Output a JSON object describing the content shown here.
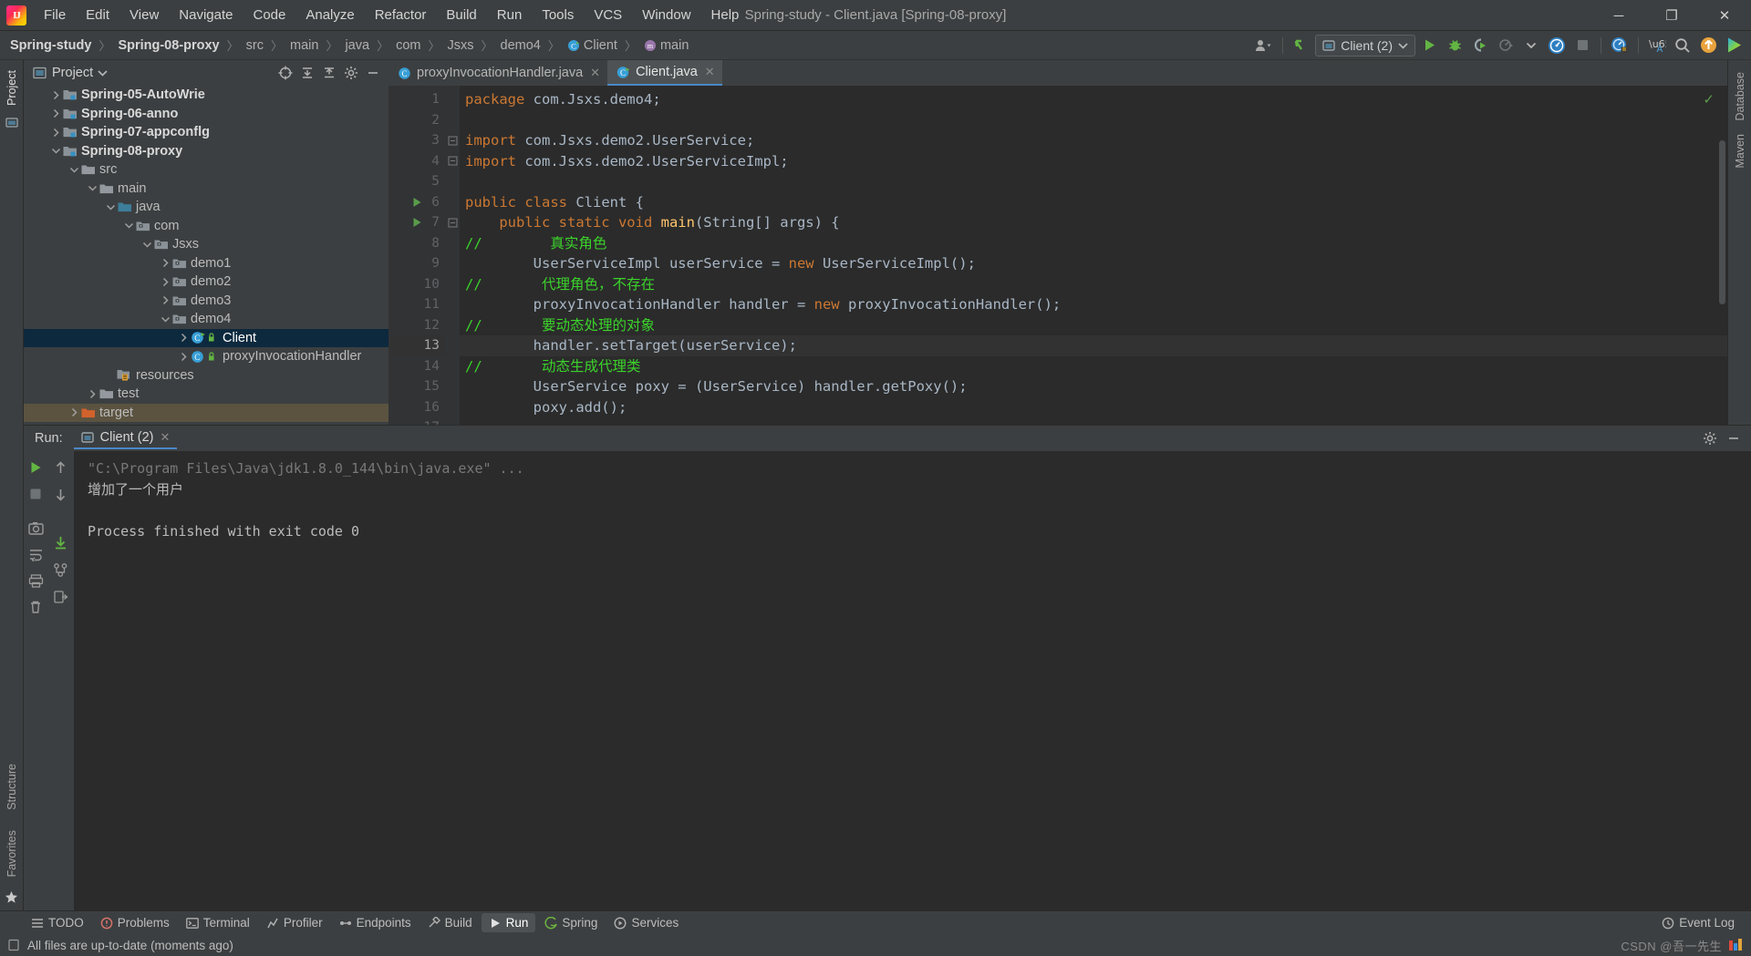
{
  "window": {
    "title": "Spring-study - Client.java [Spring-08-proxy]",
    "minimize": "─",
    "maximize": "❐",
    "close": "✕"
  },
  "menubar": {
    "items": [
      "File",
      "Edit",
      "View",
      "Navigate",
      "Code",
      "Analyze",
      "Refactor",
      "Build",
      "Run",
      "Tools",
      "VCS",
      "Window",
      "Help"
    ]
  },
  "breadcrumb": {
    "items": [
      {
        "label": "Spring-study",
        "bold": true,
        "icon": ""
      },
      {
        "label": "Spring-08-proxy",
        "bold": true,
        "icon": ""
      },
      {
        "label": "src",
        "bold": false,
        "icon": ""
      },
      {
        "label": "main",
        "bold": false,
        "icon": ""
      },
      {
        "label": "java",
        "bold": false,
        "icon": ""
      },
      {
        "label": "com",
        "bold": false,
        "icon": ""
      },
      {
        "label": "Jsxs",
        "bold": false,
        "icon": ""
      },
      {
        "label": "demo4",
        "bold": false,
        "icon": ""
      },
      {
        "label": "Client",
        "bold": false,
        "icon": "class-icon"
      },
      {
        "label": "main",
        "bold": false,
        "icon": "method-icon"
      }
    ],
    "separator": "〉"
  },
  "toolbar": {
    "run_config_label": "Client (2)",
    "icons": [
      "user-dropdown-icon",
      "update-project-icon",
      "run-icon",
      "debug-icon",
      "run-coverage-icon",
      "profiler-icon",
      "stop-icon",
      "search-everywhere-icon",
      "translate-icon",
      "search-icon",
      "upload-icon",
      "play-gradient-icon"
    ]
  },
  "project_panel": {
    "title": "Project",
    "actions": [
      "target-icon",
      "expand-all-icon",
      "collapse-all-icon",
      "settings-icon",
      "hide-icon"
    ],
    "tree": [
      {
        "label": "Spring-05-AutoWrie",
        "indent": 1,
        "arrow": "›",
        "icon": "module-folder",
        "bold": true,
        "state": ""
      },
      {
        "label": "Spring-06-anno",
        "indent": 1,
        "arrow": "›",
        "icon": "module-folder",
        "bold": true,
        "state": ""
      },
      {
        "label": "Spring-07-appconflg",
        "indent": 1,
        "arrow": "›",
        "icon": "module-folder",
        "bold": true,
        "state": ""
      },
      {
        "label": "Spring-08-proxy",
        "indent": 1,
        "arrow": "⌄",
        "icon": "module-folder",
        "bold": true,
        "state": ""
      },
      {
        "label": "src",
        "indent": 2,
        "arrow": "⌄",
        "icon": "folder-gray",
        "bold": false,
        "state": ""
      },
      {
        "label": "main",
        "indent": 3,
        "arrow": "⌄",
        "icon": "folder-gray",
        "bold": false,
        "state": ""
      },
      {
        "label": "java",
        "indent": 4,
        "arrow": "⌄",
        "icon": "folder-source",
        "bold": false,
        "state": ""
      },
      {
        "label": "com",
        "indent": 5,
        "arrow": "⌄",
        "icon": "package",
        "bold": false,
        "state": ""
      },
      {
        "label": "Jsxs",
        "indent": 6,
        "arrow": "⌄",
        "icon": "package",
        "bold": false,
        "state": ""
      },
      {
        "label": "demo1",
        "indent": 7,
        "arrow": "›",
        "icon": "package",
        "bold": false,
        "state": ""
      },
      {
        "label": "demo2",
        "indent": 7,
        "arrow": "›",
        "icon": "package",
        "bold": false,
        "state": ""
      },
      {
        "label": "demo3",
        "indent": 7,
        "arrow": "›",
        "icon": "package",
        "bold": false,
        "state": ""
      },
      {
        "label": "demo4",
        "indent": 7,
        "arrow": "⌄",
        "icon": "package",
        "bold": false,
        "state": ""
      },
      {
        "label": "Client",
        "indent": 8,
        "arrow": "›",
        "icon": "runnable-class",
        "bold": false,
        "state": "selected"
      },
      {
        "label": "proxyInvocationHandler",
        "indent": 8,
        "arrow": "›",
        "icon": "class",
        "bold": false,
        "state": ""
      },
      {
        "label": "resources",
        "indent": 4,
        "arrow": "",
        "icon": "resources-folder",
        "bold": false,
        "state": ""
      },
      {
        "label": "test",
        "indent": 3,
        "arrow": "›",
        "icon": "folder-gray",
        "bold": false,
        "state": ""
      },
      {
        "label": "target",
        "indent": 2,
        "arrow": "›",
        "icon": "folder-orange",
        "bold": false,
        "state": "highlight"
      }
    ]
  },
  "editor": {
    "tabs": [
      {
        "label": "proxyInvocationHandler.java",
        "icon": "class-icon",
        "active": false,
        "close": "✕"
      },
      {
        "label": "Client.java",
        "icon": "runnable-class-icon",
        "active": true,
        "close": "✕"
      }
    ],
    "lines": [
      {
        "num": "1",
        "run": false,
        "fold": "",
        "current": false,
        "tokens": [
          {
            "t": "kw",
            "v": "package"
          },
          {
            "t": "txt",
            "v": " com.Jsxs.demo4"
          },
          {
            "t": "sep",
            "v": ";"
          }
        ]
      },
      {
        "num": "2",
        "run": false,
        "fold": "",
        "current": false,
        "tokens": []
      },
      {
        "num": "3",
        "run": false,
        "fold": "⊟",
        "current": false,
        "tokens": [
          {
            "t": "kw",
            "v": "import"
          },
          {
            "t": "txt",
            "v": " com.Jsxs.demo2.UserService"
          },
          {
            "t": "sep",
            "v": ";"
          }
        ]
      },
      {
        "num": "4",
        "run": false,
        "fold": "⊟",
        "current": false,
        "tokens": [
          {
            "t": "kw",
            "v": "import"
          },
          {
            "t": "txt",
            "v": " com.Jsxs.demo2.UserServiceImpl"
          },
          {
            "t": "sep",
            "v": ";"
          }
        ]
      },
      {
        "num": "5",
        "run": false,
        "fold": "",
        "current": false,
        "tokens": []
      },
      {
        "num": "6",
        "run": true,
        "fold": "",
        "current": false,
        "tokens": [
          {
            "t": "kw",
            "v": "public class "
          },
          {
            "t": "txt",
            "v": "Client {"
          }
        ]
      },
      {
        "num": "7",
        "run": true,
        "fold": "⊟",
        "current": false,
        "tokens": [
          {
            "t": "txt",
            "v": "    "
          },
          {
            "t": "kw",
            "v": "public static void "
          },
          {
            "t": "fn",
            "v": "main"
          },
          {
            "t": "txt",
            "v": "(String[] args) {"
          }
        ]
      },
      {
        "num": "8",
        "run": false,
        "fold": "",
        "current": false,
        "tokens": [
          {
            "t": "cmt-green",
            "v": "//        真实角色"
          }
        ]
      },
      {
        "num": "9",
        "run": false,
        "fold": "",
        "current": false,
        "tokens": [
          {
            "t": "txt",
            "v": "        UserServiceImpl userService = "
          },
          {
            "t": "kw",
            "v": "new "
          },
          {
            "t": "txt",
            "v": "UserServiceImpl()"
          },
          {
            "t": "sep",
            "v": ";"
          }
        ]
      },
      {
        "num": "10",
        "run": false,
        "fold": "",
        "current": false,
        "tokens": [
          {
            "t": "cmt-green",
            "v": "//       代理角色，不存在"
          }
        ]
      },
      {
        "num": "11",
        "run": false,
        "fold": "",
        "current": false,
        "tokens": [
          {
            "t": "txt",
            "v": "        proxyInvocationHandler handler = "
          },
          {
            "t": "kw",
            "v": "new "
          },
          {
            "t": "txt",
            "v": "proxyInvocationHandler()"
          },
          {
            "t": "sep",
            "v": ";"
          }
        ]
      },
      {
        "num": "12",
        "run": false,
        "fold": "",
        "current": false,
        "tokens": [
          {
            "t": "cmt-green",
            "v": "//       要动态处理的对象"
          }
        ]
      },
      {
        "num": "13",
        "run": false,
        "fold": "",
        "current": true,
        "tokens": [
          {
            "t": "txt",
            "v": "        handler.setTarget(userService)"
          },
          {
            "t": "sep",
            "v": ";"
          }
        ]
      },
      {
        "num": "14",
        "run": false,
        "fold": "",
        "current": false,
        "tokens": [
          {
            "t": "cmt-green",
            "v": "//       动态生成代理类"
          }
        ]
      },
      {
        "num": "15",
        "run": false,
        "fold": "",
        "current": false,
        "tokens": [
          {
            "t": "txt",
            "v": "        UserService poxy = (UserService) handler.getPoxy()"
          },
          {
            "t": "sep",
            "v": ";"
          }
        ]
      },
      {
        "num": "16",
        "run": false,
        "fold": "",
        "current": false,
        "tokens": [
          {
            "t": "txt",
            "v": "        poxy.add()"
          },
          {
            "t": "sep",
            "v": ";"
          }
        ]
      },
      {
        "num": "17",
        "run": false,
        "fold": "",
        "current": false,
        "tokens": []
      }
    ]
  },
  "run_window": {
    "label": "Run:",
    "tab_label": "Client (2)",
    "tab_close": "✕",
    "console": [
      {
        "text": "\"C:\\Program Files\\Java\\jdk1.8.0_144\\bin\\java.exe\" ...",
        "style": "cmd"
      },
      {
        "text": "增加了一个用户",
        "style": "out"
      },
      {
        "text": "",
        "style": "out"
      },
      {
        "text": "Process finished with exit code 0",
        "style": "out"
      }
    ],
    "side_icons": [
      "run-icon",
      "stop-icon",
      "screenshot-icon",
      "print-icon",
      "export-icon",
      "trash-icon"
    ],
    "header_icons": [
      "settings-icon",
      "hide-icon"
    ]
  },
  "left_strip": {
    "top": [
      "Project"
    ],
    "bottom": [
      "Structure",
      "Favorites"
    ]
  },
  "right_strip": {
    "items": [
      "Database",
      "Maven"
    ]
  },
  "bottom_bar": {
    "items": [
      {
        "label": "TODO",
        "icon": "todo-icon",
        "active": false
      },
      {
        "label": "Problems",
        "icon": "problems-icon",
        "active": false
      },
      {
        "label": "Terminal",
        "icon": "terminal-icon",
        "active": false
      },
      {
        "label": "Profiler",
        "icon": "profiler-icon",
        "active": false
      },
      {
        "label": "Endpoints",
        "icon": "endpoints-icon",
        "active": false
      },
      {
        "label": "Build",
        "icon": "build-icon",
        "active": false
      },
      {
        "label": "Run",
        "icon": "run-icon",
        "active": true
      },
      {
        "label": "Spring",
        "icon": "spring-icon",
        "active": false
      },
      {
        "label": "Services",
        "icon": "services-icon",
        "active": false
      }
    ],
    "event_log": "Event Log"
  },
  "status_bar": {
    "message": "All files are up-to-date (moments ago)",
    "watermark": "CSDN @吾一先生"
  }
}
